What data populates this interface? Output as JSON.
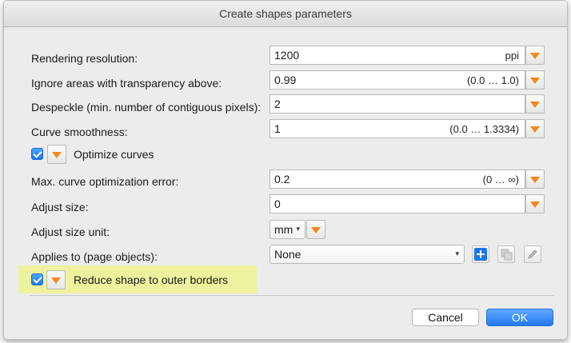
{
  "window": {
    "title": "Create shapes parameters"
  },
  "rows": {
    "resolution": {
      "label": "Rendering resolution:",
      "value": "1200",
      "unit": "ppi"
    },
    "transparency": {
      "label": "Ignore areas with transparency above:",
      "value": "0.99",
      "range": "(0.0 … 1.0)"
    },
    "despeckle": {
      "label": "Despeckle (min. number of contiguous pixels):",
      "value": "2"
    },
    "smoothness": {
      "label": "Curve smoothness:",
      "value": "1",
      "range": "(0.0 … 1.3334)"
    },
    "optimize": {
      "label": "Optimize curves",
      "checked": true
    },
    "opt_error": {
      "label": "Max. curve optimization error:",
      "value": "0.2",
      "range": "(0 … ∞)"
    },
    "adjust_size": {
      "label": "Adjust size:",
      "value": "0"
    },
    "adjust_unit": {
      "label": "Adjust size unit:",
      "value": "mm"
    },
    "applies_to": {
      "label": "Applies to (page objects):",
      "value": "None"
    },
    "reduce": {
      "label": "Reduce shape to outer borders",
      "checked": true
    }
  },
  "buttons": {
    "cancel": "Cancel",
    "ok": "OK"
  },
  "colors": {
    "accent_orange": "#f28a1c",
    "ok_blue": "#2379f2",
    "highlight": "#eef29e",
    "plus_blue": "#1b78e8"
  }
}
